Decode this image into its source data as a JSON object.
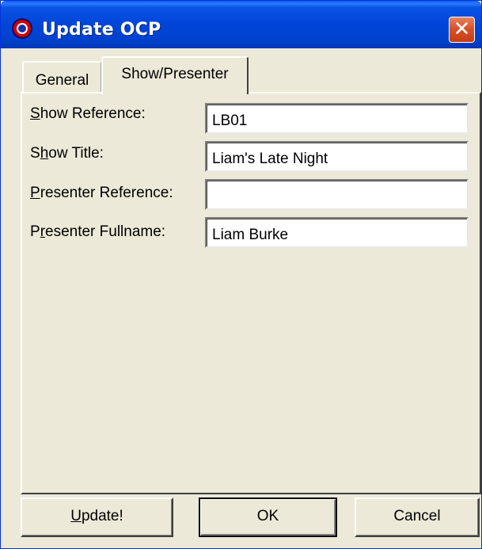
{
  "window": {
    "title": "Update OCP",
    "close_glyph": "✕"
  },
  "tabs": [
    {
      "label": "General",
      "selected": false
    },
    {
      "label": "Show/Presenter",
      "selected": true
    }
  ],
  "form": {
    "show_reference": {
      "label_key": "S",
      "label_rest": "how Reference:",
      "value": "LB01"
    },
    "show_title": {
      "label_pre": "S",
      "label_key": "h",
      "label_rest": "ow Title:",
      "value": "Liam's Late Night"
    },
    "presenter_reference": {
      "label_key": "P",
      "label_rest": "resenter Reference:",
      "value": ""
    },
    "presenter_fullname": {
      "label_pre": "P",
      "label_key": "r",
      "label_rest": "esenter Fullname:",
      "value": "Liam Burke"
    }
  },
  "buttons": {
    "update_key": "U",
    "update_rest": "pdate!",
    "ok": "OK",
    "cancel": "Cancel"
  },
  "colors": {
    "titlebar": "#0045d8",
    "dialog_bg": "#ece9d8",
    "close_button": "#d8532b"
  },
  "icons": {
    "app": "app-logo-icon",
    "close": "close-icon"
  }
}
